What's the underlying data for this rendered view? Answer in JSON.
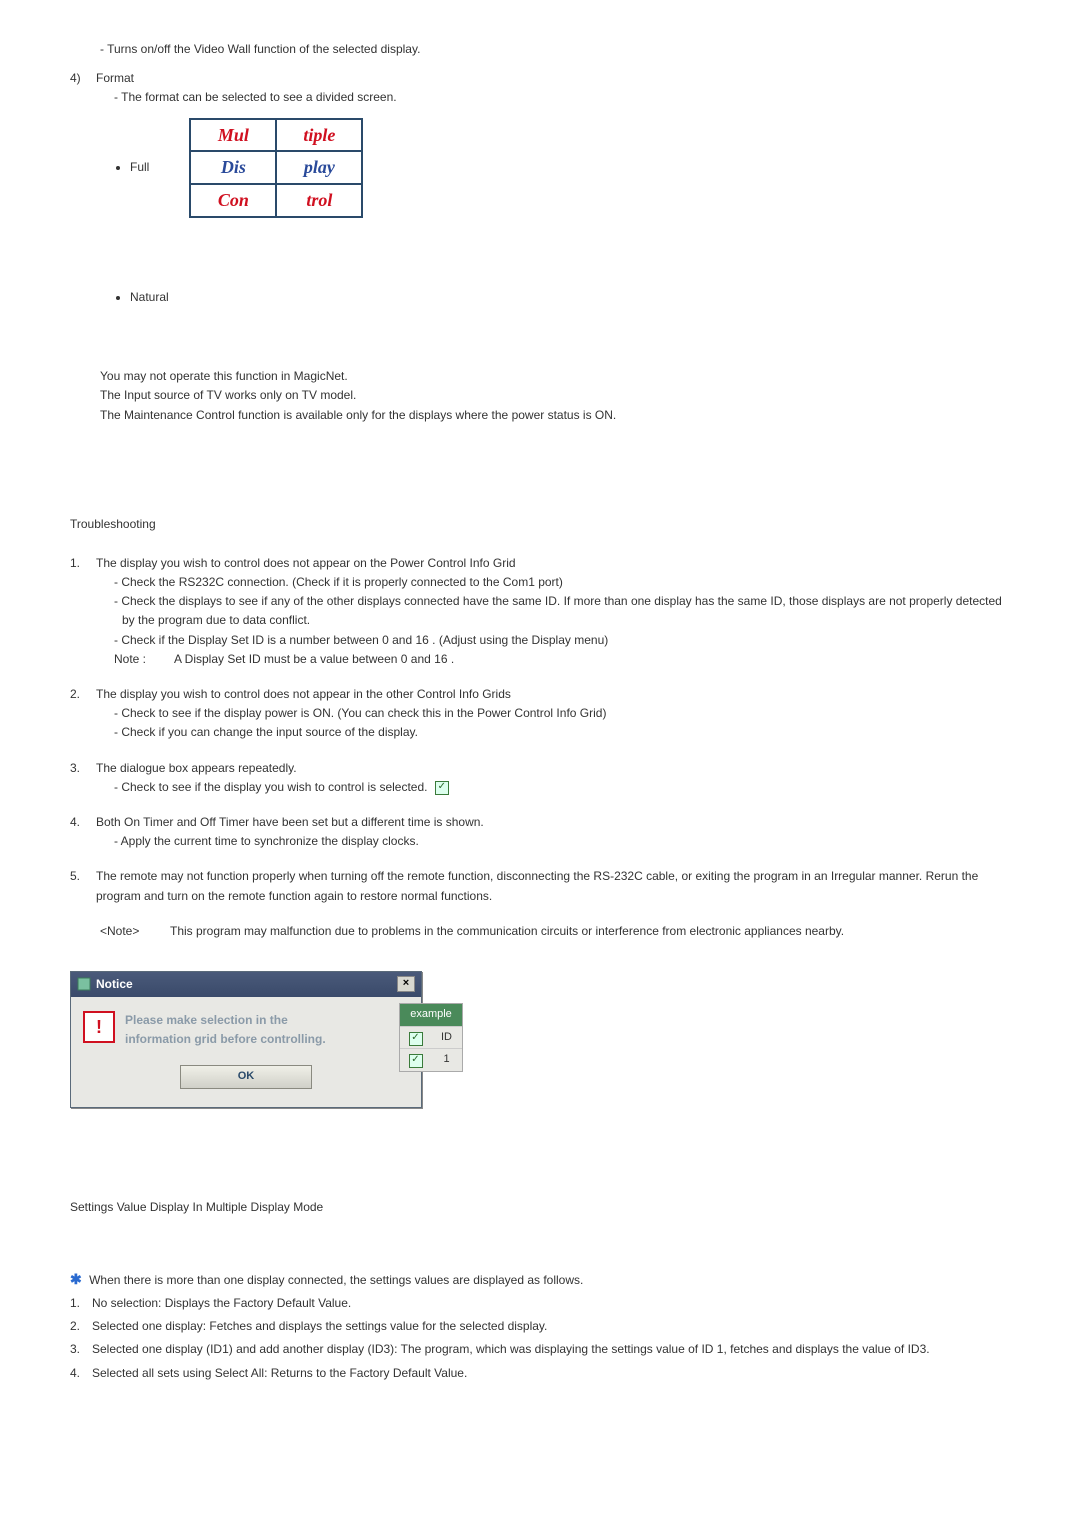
{
  "intro": {
    "videowall_desc": "- Turns on/off the Video Wall function of the selected display."
  },
  "format": {
    "num": "4)",
    "label": "Format",
    "desc": "- The format can be selected to see a divided screen.",
    "opt_full": "Full",
    "opt_natural": "Natural",
    "md_cells": [
      "Mul",
      "tiple",
      "Dis",
      "play",
      "Con",
      "trol"
    ]
  },
  "notes_block": {
    "l1": "You may not operate this function in MagicNet.",
    "l2": "The Input source of TV works only on TV model.",
    "l3": "The Maintenance Control function is available only for the displays where the power status is ON."
  },
  "troubleshooting": {
    "header": "Troubleshooting",
    "i1": {
      "num": "1.",
      "title": "The display you wish to control does not appear on the Power Control Info Grid",
      "b1": "- Check the RS232C connection. (Check if it is properly connected to the Com1 port)",
      "b2": "- Check the displays to see if any of the other displays connected have the same ID. If more than one display has the same ID, those displays are not properly detected by the program due to data conflict.",
      "b3": "- Check if the Display Set ID is a number between 0 and 16 . (Adjust using the Display menu)",
      "note_label": "Note :",
      "note_text": "A Display Set ID must be a value between 0 and 16 ."
    },
    "i2": {
      "num": "2.",
      "title": "The display you wish to control does not appear in the other Control Info Grids",
      "b1": "- Check to see if the display power is ON. (You can check this in the Power Control Info Grid)",
      "b2": "- Check if you can change the input source of the display."
    },
    "i3": {
      "num": "3.",
      "title": "The dialogue box appears repeatedly.",
      "b1": "- Check to see if the display you wish to control is selected."
    },
    "i4": {
      "num": "4.",
      "title": "Both On Timer and Off Timer have been set but a different time is shown.",
      "b1": "- Apply the current time to synchronize the display clocks."
    },
    "i5": {
      "num": "5.",
      "title": "The remote may not function properly when turning off the remote function, disconnecting the RS-232C cable, or exiting the program in an Irregular manner. Rerun the program and turn on the remote function again to restore normal functions."
    },
    "final_note_label": "<Note>",
    "final_note_text": "This program may malfunction due to problems in the communication circuits or interference from electronic appliances nearby."
  },
  "dialog": {
    "title": "Notice",
    "close": "×",
    "warn_glyph": "!",
    "msg1": "Please make selection in the",
    "msg2": "information grid before controlling.",
    "ok": "OK",
    "example_label": "example",
    "id_label": "ID",
    "id_val": "1",
    "check_glyph": "✓"
  },
  "settings_mode": {
    "header": "Settings Value Display In Multiple Display Mode",
    "intro": "When there is more than one display connected, the settings values are displayed as follows.",
    "star": "✱",
    "i1": {
      "n": "1.",
      "t": "No selection: Displays the Factory Default Value."
    },
    "i2": {
      "n": "2.",
      "t": "Selected one display: Fetches and displays the settings value for the selected display."
    },
    "i3": {
      "n": "3.",
      "t": "Selected one display (ID1) and add another display (ID3): The program, which was displaying the settings value of ID 1, fetches and displays the value of ID3."
    },
    "i4": {
      "n": "4.",
      "t": "Selected all sets using Select All: Returns to the Factory Default Value."
    }
  }
}
